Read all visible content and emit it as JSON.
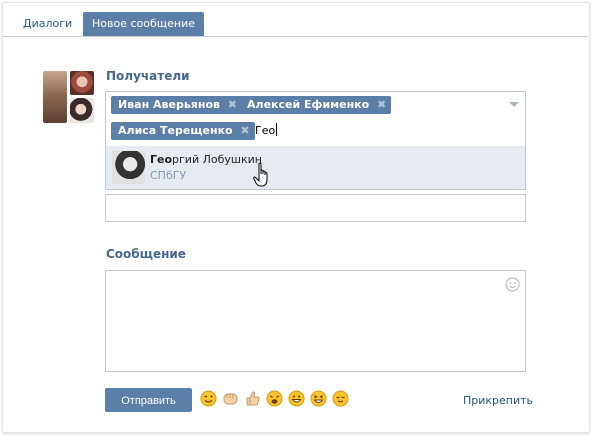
{
  "tabs": [
    {
      "label": "Диалоги"
    },
    {
      "label": "Новое сообщение",
      "active": true
    }
  ],
  "recipients": {
    "label": "Получатели",
    "tokens": [
      {
        "name": "Иван Аверьянов"
      },
      {
        "name": "Алексей Ефименко"
      },
      {
        "name": "Алиса Терещенко"
      }
    ],
    "typed_value": "Гео"
  },
  "suggestion": {
    "name_match": "Гео",
    "name_rest": "ргий Лобушкин",
    "subtitle": "СПбГУ"
  },
  "message": {
    "label": "Сообщение",
    "value": ""
  },
  "footer": {
    "send_label": "Отправить",
    "attach_label": "Прикрепить"
  },
  "emojis": [
    "winking-face",
    "fist-bump",
    "thumbs-up",
    "weary-face",
    "grinning-face",
    "squinting-laughing-face",
    "relieved-face"
  ],
  "colors": {
    "accent": "#5b7fa6",
    "link": "#2b587a",
    "label": "#45688e",
    "suggestion_bg": "#e5ebf1",
    "border": "#c0cad5"
  }
}
